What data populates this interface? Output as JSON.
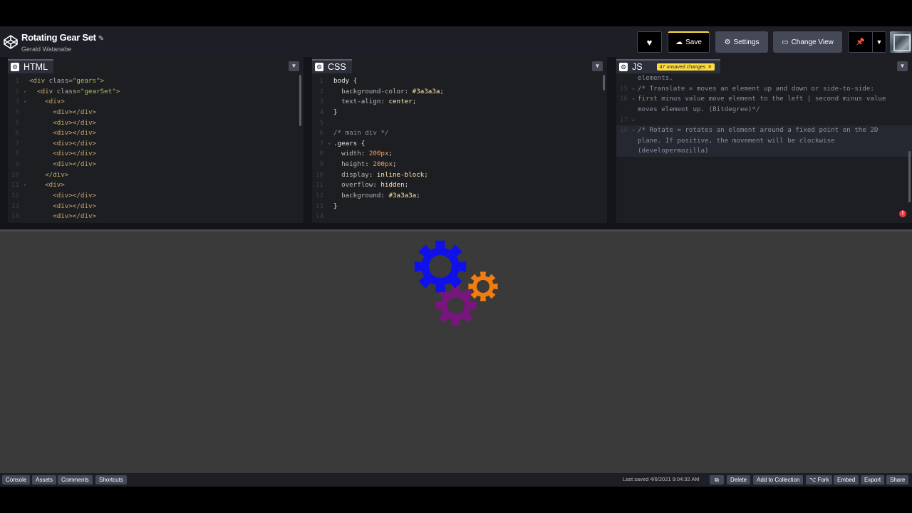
{
  "header": {
    "title": "Rotating Gear Set",
    "author": "Gerald Watanabe",
    "buttons": {
      "save": "Save",
      "settings": "Settings",
      "change_view": "Change View"
    }
  },
  "editors": {
    "html": {
      "label": "HTML",
      "lines": [
        {
          "n": "1",
          "fold": "",
          "parts": [
            [
              "tag",
              "<div "
            ],
            [
              "attr",
              "class"
            ],
            [
              "tag",
              "="
            ],
            [
              "str",
              "\"gears\""
            ],
            [
              "tag",
              ">"
            ]
          ]
        },
        {
          "n": "2",
          "fold": "▾",
          "parts": [
            [
              "",
              "  "
            ],
            [
              "tag",
              "<div "
            ],
            [
              "attr",
              "class"
            ],
            [
              "tag",
              "="
            ],
            [
              "str",
              "\"gearSet\""
            ],
            [
              "tag",
              ">"
            ]
          ]
        },
        {
          "n": "3",
          "fold": "▾",
          "parts": [
            [
              "",
              "    "
            ],
            [
              "tag",
              "<div>"
            ]
          ]
        },
        {
          "n": "4",
          "fold": "",
          "parts": [
            [
              "",
              "      "
            ],
            [
              "tag",
              "<div></div>"
            ]
          ]
        },
        {
          "n": "5",
          "fold": "",
          "parts": [
            [
              "",
              "      "
            ],
            [
              "tag",
              "<div></div>"
            ]
          ]
        },
        {
          "n": "6",
          "fold": "",
          "parts": [
            [
              "",
              "      "
            ],
            [
              "tag",
              "<div></div>"
            ]
          ]
        },
        {
          "n": "7",
          "fold": "",
          "parts": [
            [
              "",
              "      "
            ],
            [
              "tag",
              "<div></div>"
            ]
          ]
        },
        {
          "n": "8",
          "fold": "",
          "parts": [
            [
              "",
              "      "
            ],
            [
              "tag",
              "<div></div>"
            ]
          ]
        },
        {
          "n": "9",
          "fold": "",
          "parts": [
            [
              "",
              "      "
            ],
            [
              "tag",
              "<div></div>"
            ]
          ]
        },
        {
          "n": "10",
          "fold": "",
          "parts": [
            [
              "",
              "    "
            ],
            [
              "tag",
              "</div>"
            ]
          ]
        },
        {
          "n": "11",
          "fold": "▾",
          "parts": [
            [
              "",
              "    "
            ],
            [
              "tag",
              "<div>"
            ]
          ]
        },
        {
          "n": "12",
          "fold": "",
          "parts": [
            [
              "",
              "      "
            ],
            [
              "tag",
              "<div></div>"
            ]
          ]
        },
        {
          "n": "13",
          "fold": "",
          "parts": [
            [
              "",
              "      "
            ],
            [
              "tag",
              "<div></div>"
            ]
          ]
        },
        {
          "n": "14",
          "fold": "",
          "parts": [
            [
              "",
              "      "
            ],
            [
              "tag",
              "<div></div>"
            ]
          ]
        }
      ]
    },
    "css": {
      "label": "CSS",
      "lines": [
        {
          "n": "1",
          "fold": "",
          "parts": [
            [
              "sel",
              "body {"
            ]
          ]
        },
        {
          "n": "2",
          "fold": "",
          "parts": [
            [
              "",
              "  "
            ],
            [
              "prop",
              "background-color"
            ],
            [
              "",
              ": "
            ],
            [
              "val",
              "#3a3a3a"
            ],
            [
              "",
              ";"
            ]
          ]
        },
        {
          "n": "3",
          "fold": "",
          "parts": [
            [
              "",
              "  "
            ],
            [
              "prop",
              "text-align"
            ],
            [
              "",
              ": "
            ],
            [
              "val",
              "center"
            ],
            [
              "",
              ";"
            ]
          ]
        },
        {
          "n": "4",
          "fold": "",
          "parts": [
            [
              "sel",
              "}"
            ]
          ]
        },
        {
          "n": "5",
          "fold": "",
          "parts": [
            [
              "",
              ""
            ]
          ]
        },
        {
          "n": "6",
          "fold": "",
          "parts": [
            [
              "com",
              "/* main div */"
            ]
          ]
        },
        {
          "n": "7",
          "fold": "▾",
          "parts": [
            [
              "sel",
              ".gears {"
            ]
          ]
        },
        {
          "n": "8",
          "fold": "",
          "parts": [
            [
              "",
              "  "
            ],
            [
              "prop",
              "width"
            ],
            [
              "",
              ": "
            ],
            [
              "num",
              "200px"
            ],
            [
              "",
              ";"
            ]
          ]
        },
        {
          "n": "9",
          "fold": "",
          "parts": [
            [
              "",
              "  "
            ],
            [
              "prop",
              "height"
            ],
            [
              "",
              ": "
            ],
            [
              "num",
              "200px"
            ],
            [
              "",
              ";"
            ]
          ]
        },
        {
          "n": "10",
          "fold": "",
          "parts": [
            [
              "",
              "  "
            ],
            [
              "prop",
              "display"
            ],
            [
              "",
              ": "
            ],
            [
              "val",
              "inline-block"
            ],
            [
              "",
              ";"
            ]
          ]
        },
        {
          "n": "11",
          "fold": "",
          "parts": [
            [
              "",
              "  "
            ],
            [
              "prop",
              "overflow"
            ],
            [
              "",
              ": "
            ],
            [
              "val",
              "hidden"
            ],
            [
              "",
              ";"
            ]
          ]
        },
        {
          "n": "12",
          "fold": "",
          "parts": [
            [
              "",
              "  "
            ],
            [
              "prop",
              "background"
            ],
            [
              "",
              ": "
            ],
            [
              "val",
              "#3a3a3a"
            ],
            [
              "",
              ";"
            ]
          ]
        },
        {
          "n": "13",
          "fold": "",
          "parts": [
            [
              "sel",
              "}"
            ]
          ]
        },
        {
          "n": "14",
          "fold": "",
          "parts": [
            [
              "",
              ""
            ]
          ]
        }
      ]
    },
    "js": {
      "label": "JS",
      "unsaved_badge": "47 unsaved changes",
      "lines": [
        {
          "n": "",
          "active": false,
          "text": "elements."
        },
        {
          "n": "15",
          "active": false,
          "text": "/* Translate = moves an element up and down or side-to-side:"
        },
        {
          "n": "16",
          "active": false,
          "text": "first minus value move element to the left | second minus value"
        },
        {
          "n": "",
          "active": false,
          "text": "moves element up. (Bitdegree)*/"
        },
        {
          "n": "17",
          "active": false,
          "text": ""
        },
        {
          "n": "18",
          "active": true,
          "text": "/* Rotate = rotates an element around a fixed point on the 2D"
        },
        {
          "n": "",
          "active": true,
          "text": "plane. If positive, the movement will be clockwise"
        },
        {
          "n": "",
          "active": true,
          "text": "(developermozilla)"
        }
      ]
    }
  },
  "preview": {
    "gears": [
      {
        "name": "blue-gear",
        "color": "#1010e8"
      },
      {
        "name": "orange-gear",
        "color": "#f07d0e"
      },
      {
        "name": "purple-gear",
        "color": "#7a1580"
      }
    ]
  },
  "footer": {
    "left": [
      "Console",
      "Assets",
      "Comments",
      "Shortcuts"
    ],
    "last_saved": "Last saved 4/6/2021 9:04:32 AM",
    "right": [
      "Delete",
      "Add to Collection",
      "Fork",
      "Embed",
      "Export",
      "Share"
    ]
  }
}
